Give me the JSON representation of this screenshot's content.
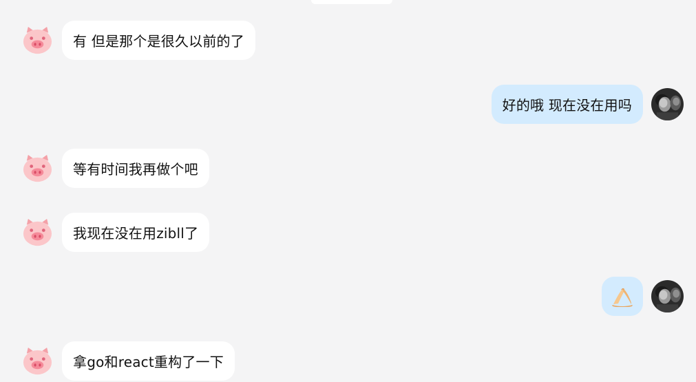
{
  "colors": {
    "background": "#f4f4f5",
    "incoming_bubble": "#ffffff",
    "outgoing_bubble": "#d3ebfe",
    "pig_pink": "#fbc6c9"
  },
  "icons": {
    "incoming_avatar": "pig-avatar-icon",
    "outgoing_avatar": "user-photo-avatar",
    "sticker": "pinched-fingers-emoji"
  },
  "messages": [
    {
      "side": "left",
      "text": "有 但是那个是很久以前的了"
    },
    {
      "side": "right",
      "text": "好的哦 现在没在用吗"
    },
    {
      "side": "left",
      "text": "等有时间我再做个吧"
    },
    {
      "side": "left",
      "text": "我现在没在用zibll了"
    },
    {
      "side": "right",
      "text": "",
      "sticker": "pinched-fingers-emoji"
    },
    {
      "side": "left",
      "text": "拿go和react重构了一下"
    }
  ]
}
